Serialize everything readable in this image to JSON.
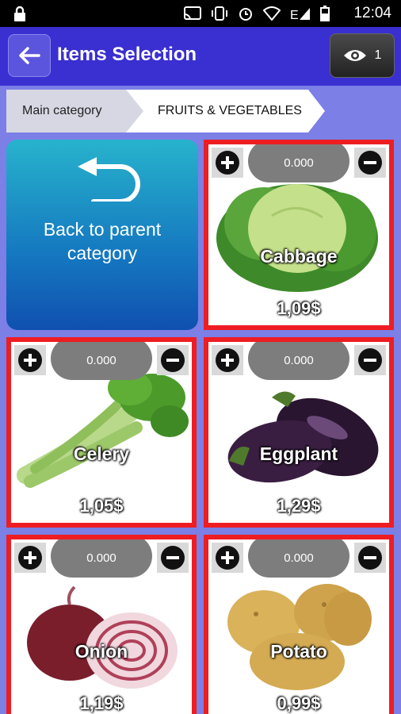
{
  "status": {
    "time": "12:04",
    "icons": [
      "lock-icon",
      "cast-icon",
      "vibrate-icon",
      "alarm-icon",
      "wifi-icon",
      "signal-icon",
      "battery-icon"
    ],
    "network": "E"
  },
  "appbar": {
    "title": "Items Selection",
    "eye_count": "1"
  },
  "breadcrumb": {
    "main": "Main category",
    "current": "FRUITS & VEGETABLES"
  },
  "back_card": {
    "label": "Back to parent category"
  },
  "items": [
    {
      "name": "Cabbage",
      "price": "1,09$",
      "qty": "0.000",
      "icon": "cabbage-image"
    },
    {
      "name": "Celery",
      "price": "1,05$",
      "qty": "0.000",
      "icon": "celery-image"
    },
    {
      "name": "Eggplant",
      "price": "1,29$",
      "qty": "0.000",
      "icon": "eggplant-image"
    },
    {
      "name": "Onion",
      "price": "1,19$",
      "qty": "0.000",
      "icon": "onion-image"
    },
    {
      "name": "Potato",
      "price": "0,99$",
      "qty": "0.000",
      "icon": "potato-image"
    }
  ],
  "colors": {
    "appbar": "#3a2fd0",
    "background": "#7b7fe6",
    "tile_border": "#ee1d23"
  }
}
